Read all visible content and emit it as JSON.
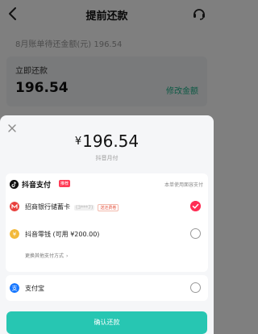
{
  "header": {
    "title": "提前还款",
    "back_icon": "chevron-left-icon",
    "service_icon": "headset-icon"
  },
  "background": {
    "bill_hint": "8月账单待还金额(元) 196.54",
    "pay_label": "立即还款",
    "pay_amount": "196.54",
    "edit_amount": "修改金额",
    "accent": "#1bb38a"
  },
  "sheet": {
    "close_icon": "close-icon",
    "currency": "¥",
    "amount": "196.54",
    "subtitle": "抖音月付",
    "douyin_pay": {
      "name": "抖音支付",
      "badge": "推荐",
      "note": "本单使用面容支付",
      "logo_icon": "douyin-logo-icon"
    },
    "methods": [
      {
        "name": "招商银行储蓄卡",
        "masked_number": "(3***7)",
        "tag": "送还费卷",
        "icon": "cmb-bank-icon",
        "icon_color": "#e8403d",
        "selected": true
      },
      {
        "name": "抖音零钱 (可用 ¥200.00)",
        "icon": "coin-icon",
        "icon_color": "#f2b93b",
        "selected": false
      }
    ],
    "more_methods": "更换其他支付方式",
    "more_icon": "chevron-right-icon",
    "alipay": {
      "name": "支付宝",
      "icon": "alipay-icon",
      "icon_color": "#1677ff",
      "selected": false
    },
    "confirm_label": "确认还款",
    "confirm_color": "#27c6b2",
    "radio_selected_color": "#ff2e55"
  }
}
